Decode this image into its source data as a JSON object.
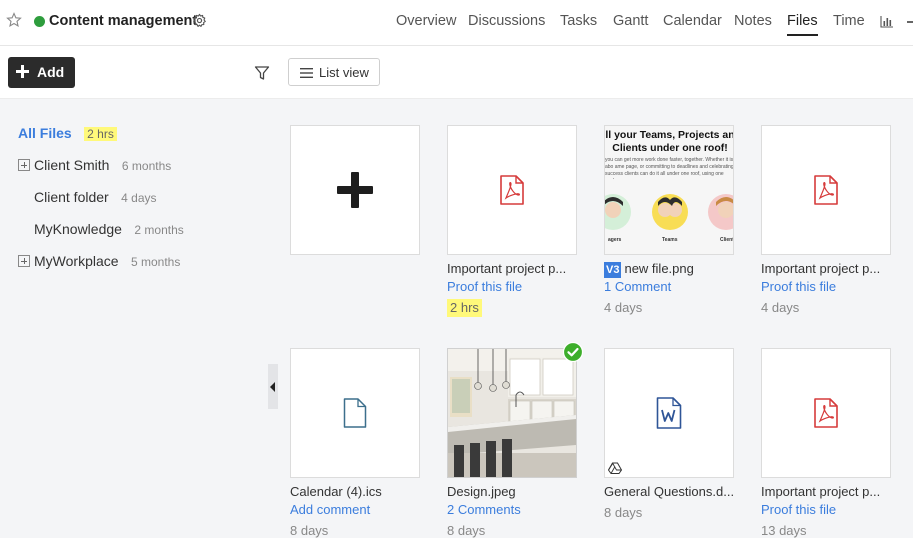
{
  "header": {
    "project_title": "Content management",
    "status_color": "#2e9d3d",
    "icons": [
      "star-icon",
      "gear-icon",
      "chart-icon"
    ],
    "nav": [
      {
        "label": "Overview"
      },
      {
        "label": "Discussions"
      },
      {
        "label": "Tasks"
      },
      {
        "label": "Gantt"
      },
      {
        "label": "Calendar"
      },
      {
        "label": "Notes"
      },
      {
        "label": "Files",
        "active": true
      },
      {
        "label": "Time"
      }
    ]
  },
  "toolbar": {
    "add_label": "Add",
    "list_view_label": "List view",
    "icons": [
      "plus-icon",
      "filter-icon",
      "list-icon"
    ]
  },
  "sidebar": {
    "items": [
      {
        "label": "All Files",
        "time": "2 hrs",
        "selected": true,
        "highlight": true
      },
      {
        "label": "Client Smith",
        "time": "6 months",
        "expandable": true
      },
      {
        "label": "Client folder",
        "time": "4 days"
      },
      {
        "label": "MyKnowledge",
        "time": "2 months"
      },
      {
        "label": "MyWorkplace",
        "time": "5 months",
        "expandable": true
      }
    ]
  },
  "files": [
    {
      "type": "new",
      "icon": "big-plus-icon"
    },
    {
      "name": "Important project p...",
      "link": "Proof this file",
      "time": "2 hrs",
      "time_highlight": true,
      "icon": "pdf-icon"
    },
    {
      "name": "new file.png",
      "version": "V3",
      "link": "1 Comment",
      "time": "4 days",
      "preview": {
        "line1": "ll your Teams, Projects an",
        "line2": "Clients under one roof!",
        "body": "you can get more work done faster, together. Whether it is abo ame page, or committing to deadlines and celebrating success clients can do it all under one roof, using one work managemen",
        "captions": [
          "agers",
          "Teams",
          "Client"
        ]
      }
    },
    {
      "name": "Important project p...",
      "link": "Proof this file",
      "time": "4 days",
      "icon": "pdf-icon"
    },
    {
      "name": "Calendar (4).ics",
      "link": "Add comment",
      "time": "8 days",
      "icon": "file-icon"
    },
    {
      "name": "Design.jpeg",
      "link": "2 Comments",
      "time": "8 days",
      "icon": "check-icon",
      "preview": "kitchen-photo"
    },
    {
      "name": "General Questions.d...",
      "link": "",
      "time": "8 days",
      "icon": "word-icon",
      "sub_icon": "drive-icon"
    },
    {
      "name": "Important project p...",
      "link": "Proof this file",
      "time": "13 days",
      "icon": "pdf-icon"
    }
  ],
  "colors": {
    "accent": "#3b7ddd",
    "pdf": "#d63b3b",
    "highlight": "#fff97a",
    "approved": "#3dae2b"
  }
}
